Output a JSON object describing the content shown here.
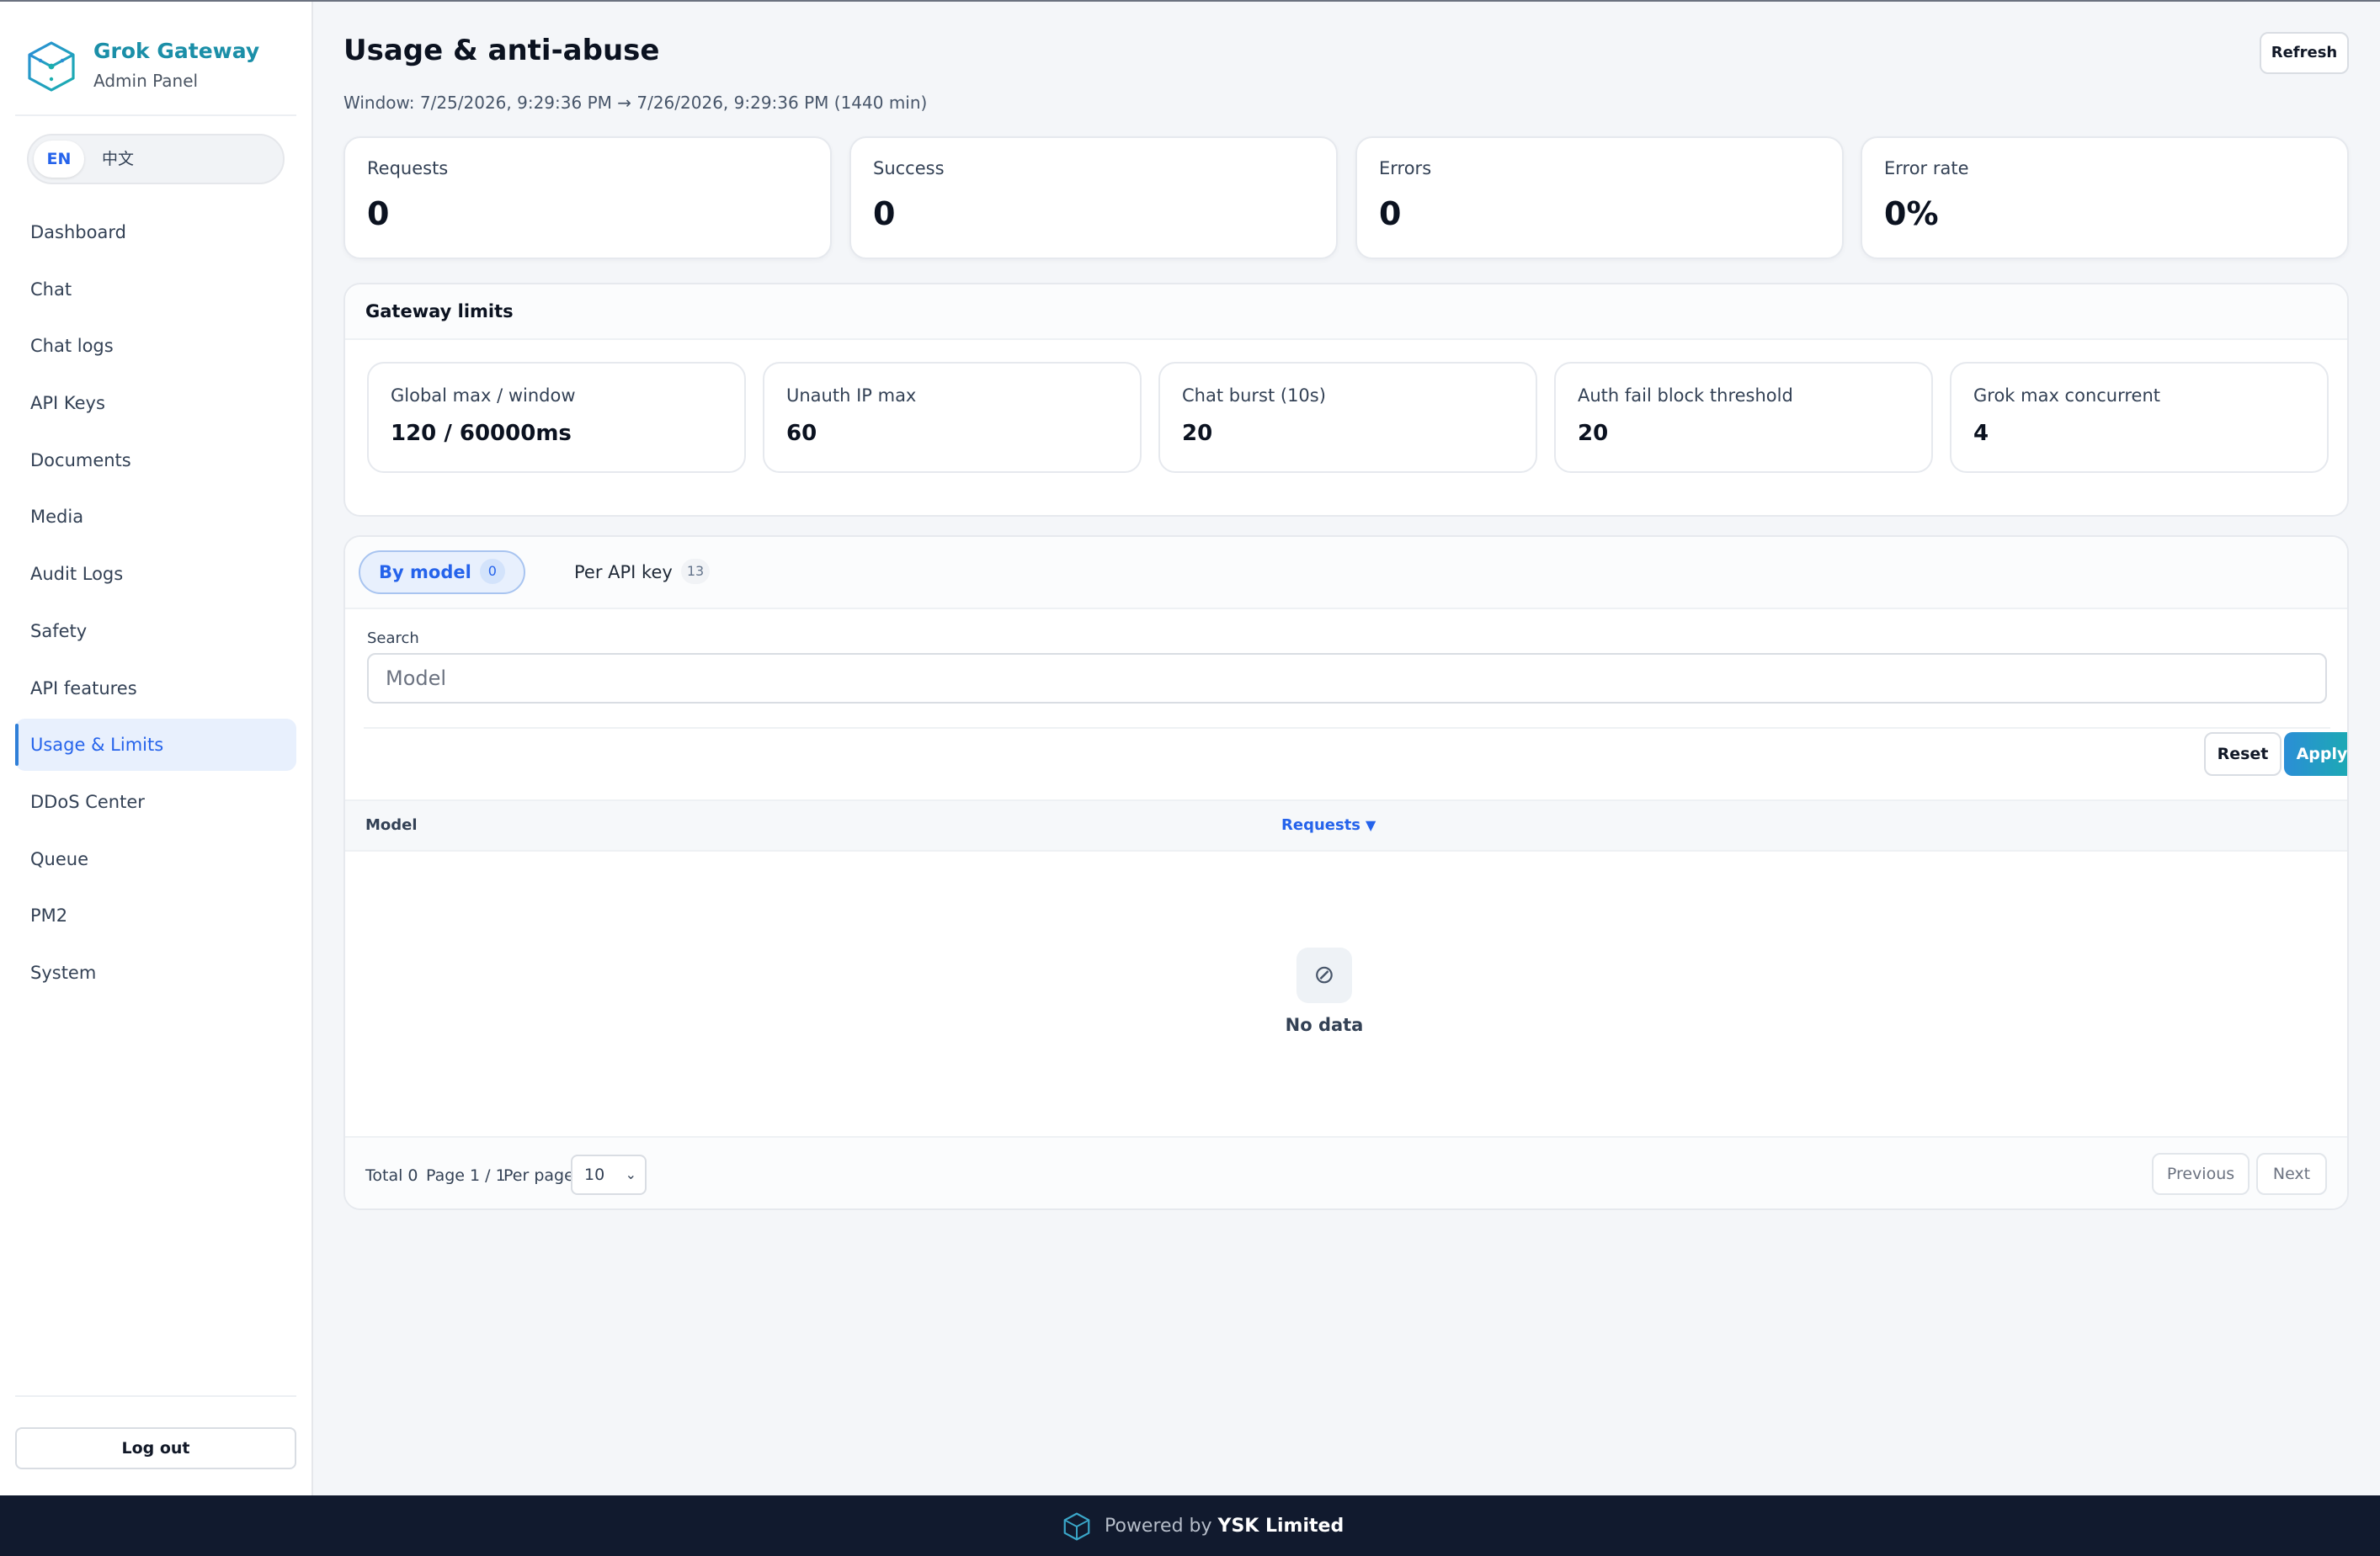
{
  "brand": {
    "title": "Grok Gateway",
    "subtitle": "Admin Panel"
  },
  "lang": {
    "en": "EN",
    "zh": "中文"
  },
  "nav": {
    "items": [
      {
        "label": "Dashboard",
        "active": false
      },
      {
        "label": "Chat",
        "active": false
      },
      {
        "label": "Chat logs",
        "active": false
      },
      {
        "label": "API Keys",
        "active": false
      },
      {
        "label": "Documents",
        "active": false
      },
      {
        "label": "Media",
        "active": false
      },
      {
        "label": "Audit Logs",
        "active": false
      },
      {
        "label": "Safety",
        "active": false
      },
      {
        "label": "API features",
        "active": false
      },
      {
        "label": "Usage & Limits",
        "active": true
      },
      {
        "label": "DDoS Center",
        "active": false
      },
      {
        "label": "Queue",
        "active": false
      },
      {
        "label": "PM2",
        "active": false
      },
      {
        "label": "System",
        "active": false
      }
    ],
    "logout": "Log out"
  },
  "header": {
    "title": "Usage & anti-abuse",
    "window": "Window: 7/25/2026, 9:29:36 PM → 7/26/2026, 9:29:36 PM (1440 min)",
    "refresh": "Refresh"
  },
  "stats": [
    {
      "label": "Requests",
      "value": "0"
    },
    {
      "label": "Success",
      "value": "0"
    },
    {
      "label": "Errors",
      "value": "0"
    },
    {
      "label": "Error rate",
      "value": "0%"
    }
  ],
  "limits": {
    "title": "Gateway limits",
    "items": [
      {
        "label": "Global max / window",
        "value": "120 / 60000ms"
      },
      {
        "label": "Unauth IP max",
        "value": "60"
      },
      {
        "label": "Chat burst (10s)",
        "value": "20"
      },
      {
        "label": "Auth fail block threshold",
        "value": "20"
      },
      {
        "label": "Grok max concurrent",
        "value": "4"
      }
    ]
  },
  "tabs": [
    {
      "label": "By model",
      "count": "0",
      "active": true
    },
    {
      "label": "Per API key",
      "count": "13",
      "active": false
    }
  ],
  "search": {
    "label": "Search",
    "placeholder": "Model",
    "value": ""
  },
  "actions": {
    "reset": "Reset",
    "apply": "Apply"
  },
  "table": {
    "columns": {
      "model": "Model",
      "requests": "Requests"
    },
    "sort_indicator": "▼",
    "empty_icon": "⊘",
    "empty_text": "No data"
  },
  "pagination": {
    "total": "Total 0",
    "page": "Page 1 / 1",
    "per_page_label": "Per page",
    "per_page_value": "10",
    "previous": "Previous",
    "next": "Next"
  },
  "footer": {
    "prefix": "Powered by ",
    "brand": "YSK Limited"
  },
  "colors": {
    "accent": "#2563eb",
    "brand": "#1b8fa8",
    "footer_bg": "#111a2e"
  }
}
